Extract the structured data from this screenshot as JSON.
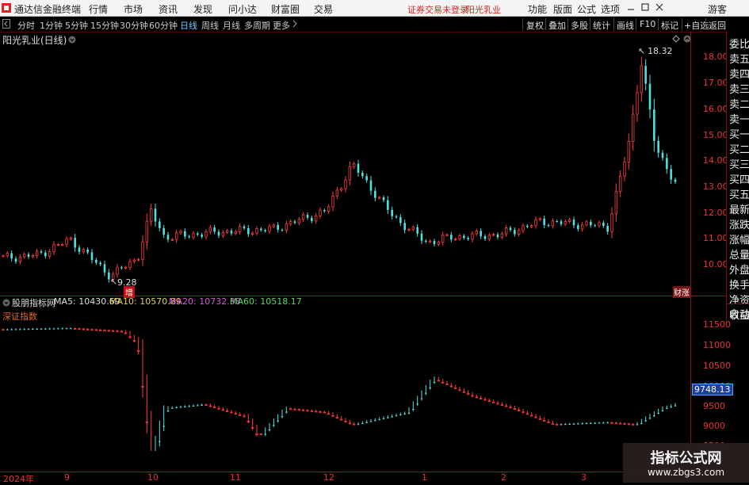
{
  "menubar": {
    "app_title": "通达信金融终端",
    "menus": [
      "行情",
      "市场",
      "资讯",
      "发现",
      "问小达",
      "财富圈",
      "交易"
    ],
    "notice": "证券交易未登录",
    "stock_name": "阳光乳业",
    "right_menus": [
      "功能",
      "版面",
      "公式",
      "选项"
    ],
    "user": "游客"
  },
  "toolbar": {
    "periods": [
      "分时",
      "1分钟",
      "5分钟",
      "15分钟",
      "30分钟",
      "60分钟",
      "日线",
      "周线",
      "月线",
      "多周期",
      "更多"
    ],
    "selected_period": "日线",
    "right_buttons": [
      "复权",
      "叠加",
      "多股",
      "统计",
      "画线",
      "F10",
      "标记",
      "+自选",
      "返回"
    ]
  },
  "main_chart": {
    "title": "阳光乳业(日线)",
    "high_label": "18.32",
    "low_label": "9.28",
    "zeng_badge": "增",
    "corner_tags": "财涨",
    "y_ticks": [
      "18.00",
      "17.00",
      "16.00",
      "15.00",
      "14.00",
      "13.00",
      "12.00",
      "11.00",
      "10.00"
    ]
  },
  "sub_chart": {
    "indicator_name": "股朋指标网",
    "ma5": "MA5: 10430.69",
    "ma10": "MA10: 10570.89",
    "ma20": "MA20: 10732.38",
    "ma60": "MA60: 10518.17",
    "index_name": "深证指数",
    "y_ticks": [
      "11500",
      "11000",
      "10500",
      "10000",
      "9500",
      "9000",
      "8500"
    ],
    "last_value": "9748.13"
  },
  "x_axis": {
    "labels": [
      "2024年",
      "9",
      "10",
      "11",
      "12",
      "1",
      "2",
      "3"
    ]
  },
  "side_panel": {
    "items": [
      "委比",
      "卖五",
      "卖四",
      "卖三",
      "卖二",
      "卖一",
      "买一",
      "买二",
      "买三",
      "买四",
      "买五",
      "最新",
      "涨跌",
      "涨幅",
      "总量",
      "外盘",
      "换手",
      "净资",
      "收益"
    ],
    "auto_label": "自动"
  },
  "watermark": {
    "line1": "指标公式网",
    "line2": "www.zbgs3.com"
  },
  "colors": {
    "up": "#ff3b3b",
    "down": "#4fe0e0",
    "axis_red": "#ee3333",
    "ma5": "#dddddd",
    "ma10": "#e6d24a",
    "ma20": "#d85ad8",
    "ma60": "#5ad85a"
  }
}
